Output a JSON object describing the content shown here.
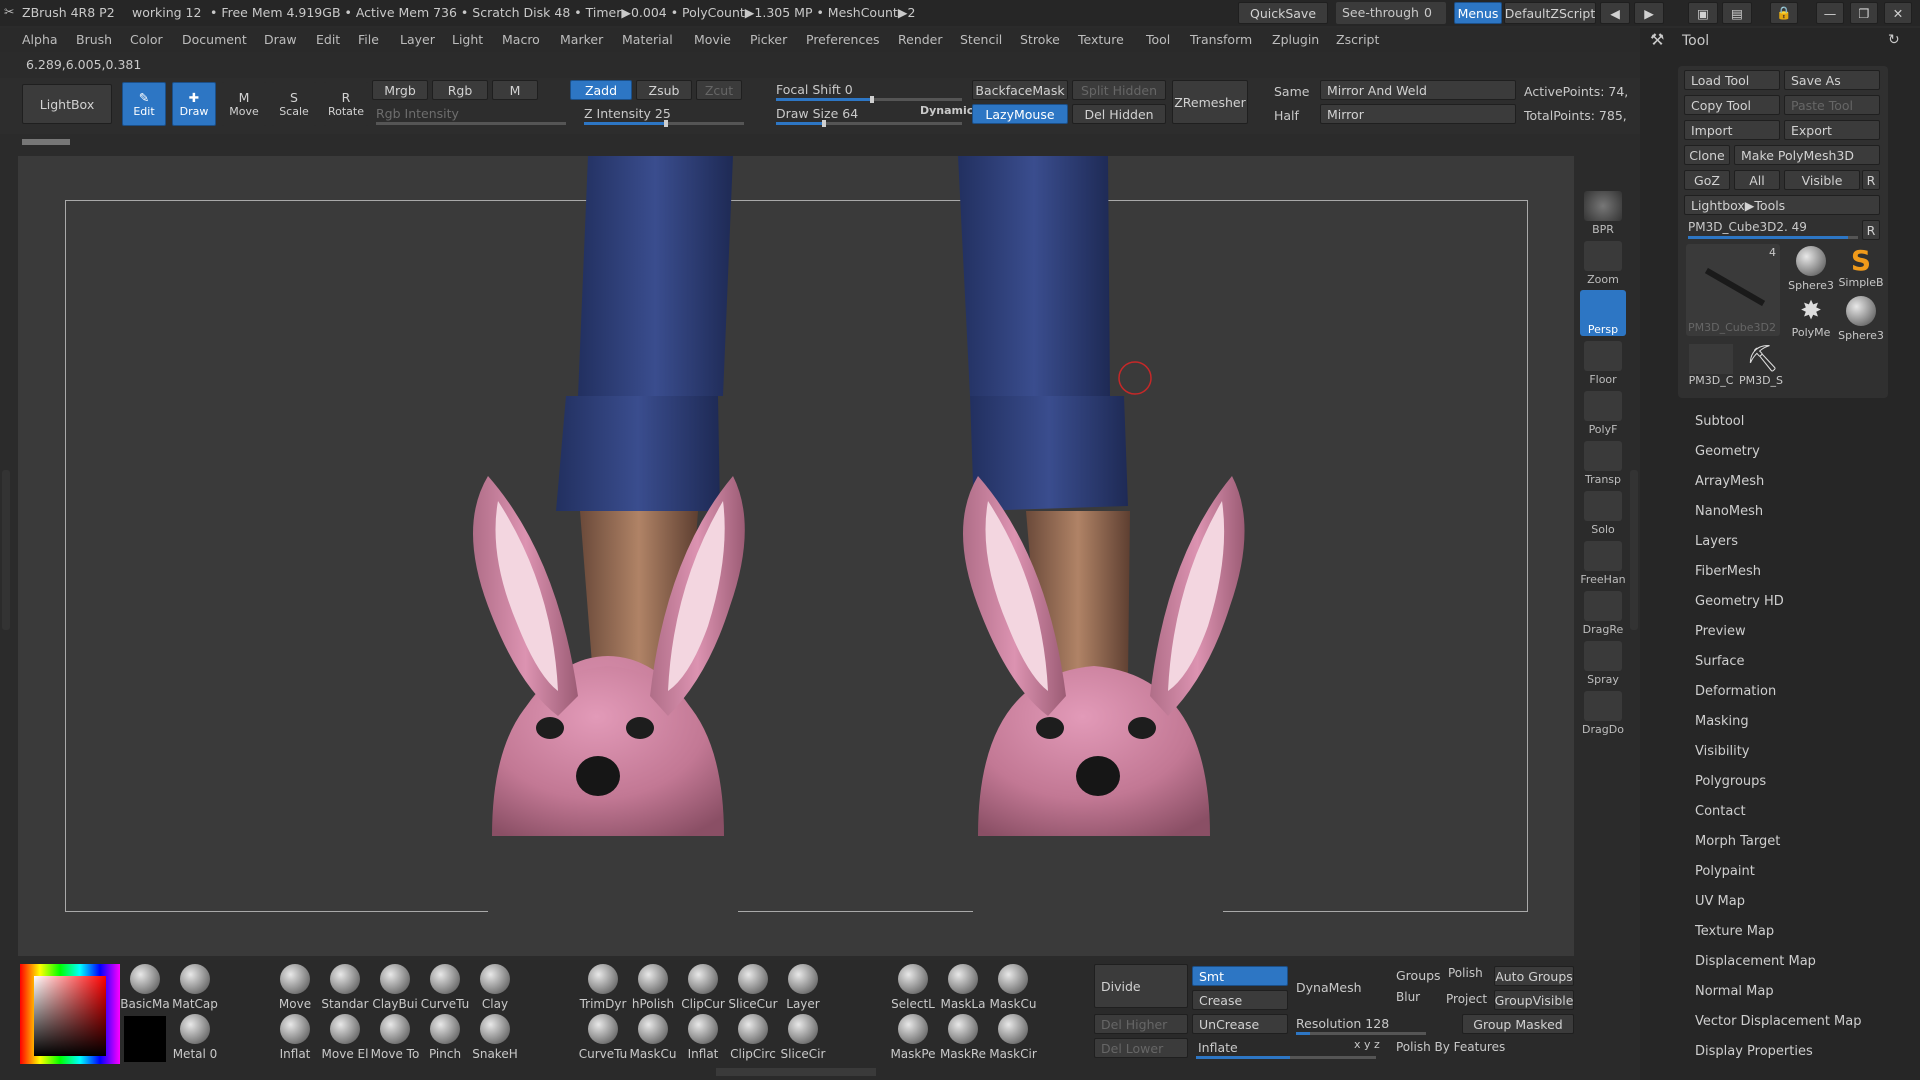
{
  "titlebar": {
    "app": "ZBrush 4R8 P2",
    "doc": "working 12",
    "stats": "• Free Mem 4.919GB • Active Mem 736 • Scratch Disk 48 • Timer▶0.004 • PolyCount▶1.305 MP • MeshCount▶2",
    "quicksave": "QuickSave",
    "seethrough": "See-through",
    "seethrough_value": "0",
    "menus": "Menus",
    "defaultzscript": "DefaultZScript"
  },
  "menu": [
    "Alpha",
    "Brush",
    "Color",
    "Document",
    "Draw",
    "Edit",
    "File",
    "Layer",
    "Light",
    "Macro",
    "Marker",
    "Material",
    "Movie",
    "Picker",
    "Preferences",
    "Render",
    "Stencil",
    "Stroke",
    "Texture",
    "Tool",
    "Transform",
    "Zplugin",
    "Zscript"
  ],
  "coords": "6.289,6.005,0.381",
  "toolbar": {
    "lightbox": "LightBox",
    "edit": "Edit",
    "draw": "Draw",
    "move": "Move",
    "scale": "Scale",
    "rotate": "Rotate",
    "mrgb": "Mrgb",
    "rgb": "Rgb",
    "m": "M",
    "zadd": "Zadd",
    "zsub": "Zsub",
    "zcut": "Zcut",
    "rgb_intensity": "Rgb Intensity",
    "z_intensity": "Z Intensity 25",
    "focal_shift": "Focal Shift 0",
    "draw_size": "Draw Size 64",
    "dynamic": "Dynamic",
    "backfacemask": "BackfaceMask",
    "split_hidden": "Split Hidden",
    "lazymouse": "LazyMouse",
    "del_hidden": "Del Hidden",
    "zremesher": "ZRemesher",
    "same": "Same",
    "half": "Half",
    "mirror_weld": "Mirror And Weld",
    "mirror": "Mirror",
    "active_points": "ActivePoints: 74,",
    "total_points": "TotalPoints: 785,"
  },
  "righttools": [
    "BPR",
    "Zoom",
    "Persp",
    "Floor",
    "PolyF",
    "Transp",
    "Solo",
    "FreeHan",
    "DragRe",
    "Spray",
    "DragDo"
  ],
  "toolpanel": {
    "title": "Tool",
    "load": "Load Tool",
    "saveas": "Save As",
    "copy": "Copy Tool",
    "paste": "Paste Tool",
    "import": "Import",
    "export": "Export",
    "clone": "Clone",
    "makepoly": "Make PolyMesh3D",
    "goz": "GoZ",
    "all": "All",
    "visible": "Visible",
    "r": "R",
    "lightbox_tools": "Lightbox▶Tools",
    "current": "PM3D_Cube3D2. 49",
    "thumbs": [
      "PM3D_Cube3D2",
      "Sphere3",
      "SimpleB",
      "PolyMe",
      "Sphere3",
      "PM3D_C",
      "PM3D_S"
    ],
    "thumb_count": "4",
    "sections": [
      "Subtool",
      "Geometry",
      "ArrayMesh",
      "NanoMesh",
      "Layers",
      "FiberMesh",
      "Geometry HD",
      "Preview",
      "Surface",
      "Deformation",
      "Masking",
      "Visibility",
      "Polygroups",
      "Contact",
      "Morph Target",
      "Polypaint",
      "UV Map",
      "Texture Map",
      "Displacement Map",
      "Normal Map",
      "Vector Displacement Map",
      "Display Properties"
    ]
  },
  "bottom": {
    "materials": [
      "BasicMa",
      "MatCap",
      "Metal 0"
    ],
    "brushes": [
      "Move",
      "Standar",
      "ClayBui",
      "CurveTu",
      "Clay",
      "Inflat",
      "Move El",
      "Move To",
      "Pinch",
      "SnakeH"
    ],
    "brushes2": [
      "TrimDyr",
      "hPolish",
      "ClipCur",
      "SliceCur",
      "Layer",
      "CurveTu",
      "MaskCu",
      "Inflat",
      "ClipCirc",
      "SliceCir"
    ],
    "brushes3": [
      "SelectL",
      "MaskLa",
      "MaskCu",
      "MaskPe",
      "MaskRe",
      "MaskCir"
    ],
    "divide": "Divide",
    "smt": "Smt",
    "dynamesh": "DynaMesh",
    "groups": "Groups",
    "polish": "Polish",
    "autogroups": "Auto Groups",
    "crease": "Crease",
    "blur": "Blur",
    "project": "Project",
    "groupvisible": "GroupVisible",
    "delhigher": "Del Higher",
    "uncrease": "UnCrease",
    "resolution": "Resolution 128",
    "groupmasked": "Group Masked",
    "dellower": "Del Lower",
    "inflate": "Inflate",
    "polishfeat": "Polish By Features",
    "xyz": "x y z"
  },
  "colors": {
    "accent": "#2d76c4",
    "slipper": "#c97f9f",
    "jeans": "#2e3f7a"
  }
}
